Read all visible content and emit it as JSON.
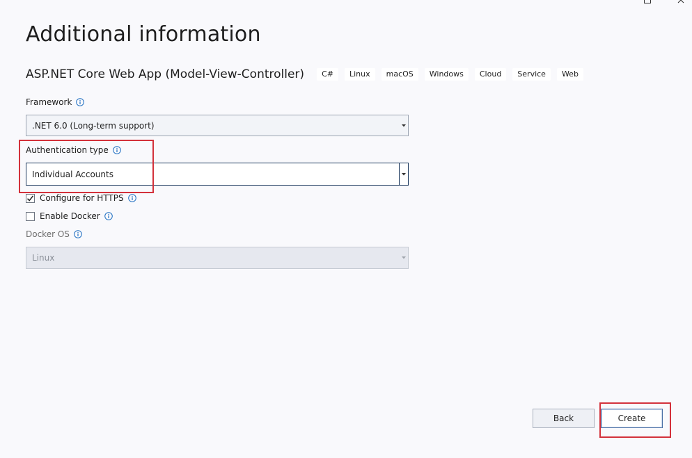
{
  "window": {
    "maximize_icon": "maximize-icon",
    "close_icon": "close-icon"
  },
  "page": {
    "title": "Additional information"
  },
  "template": {
    "name": "ASP.NET Core Web App (Model-View-Controller)",
    "tags": [
      "C#",
      "Linux",
      "macOS",
      "Windows",
      "Cloud",
      "Service",
      "Web"
    ]
  },
  "framework": {
    "label": "Framework",
    "value": ".NET 6.0 (Long-term support)"
  },
  "authentication": {
    "label": "Authentication type",
    "value": "Individual Accounts"
  },
  "https": {
    "label": "Configure for HTTPS",
    "checked": true
  },
  "docker": {
    "label": "Enable Docker",
    "checked": false
  },
  "docker_os": {
    "label": "Docker OS",
    "value": "Linux"
  },
  "buttons": {
    "back": "Back",
    "create": "Create"
  },
  "colors": {
    "accent": "#005fb8",
    "highlight": "#d3313b",
    "background": "#f9f9fc"
  }
}
